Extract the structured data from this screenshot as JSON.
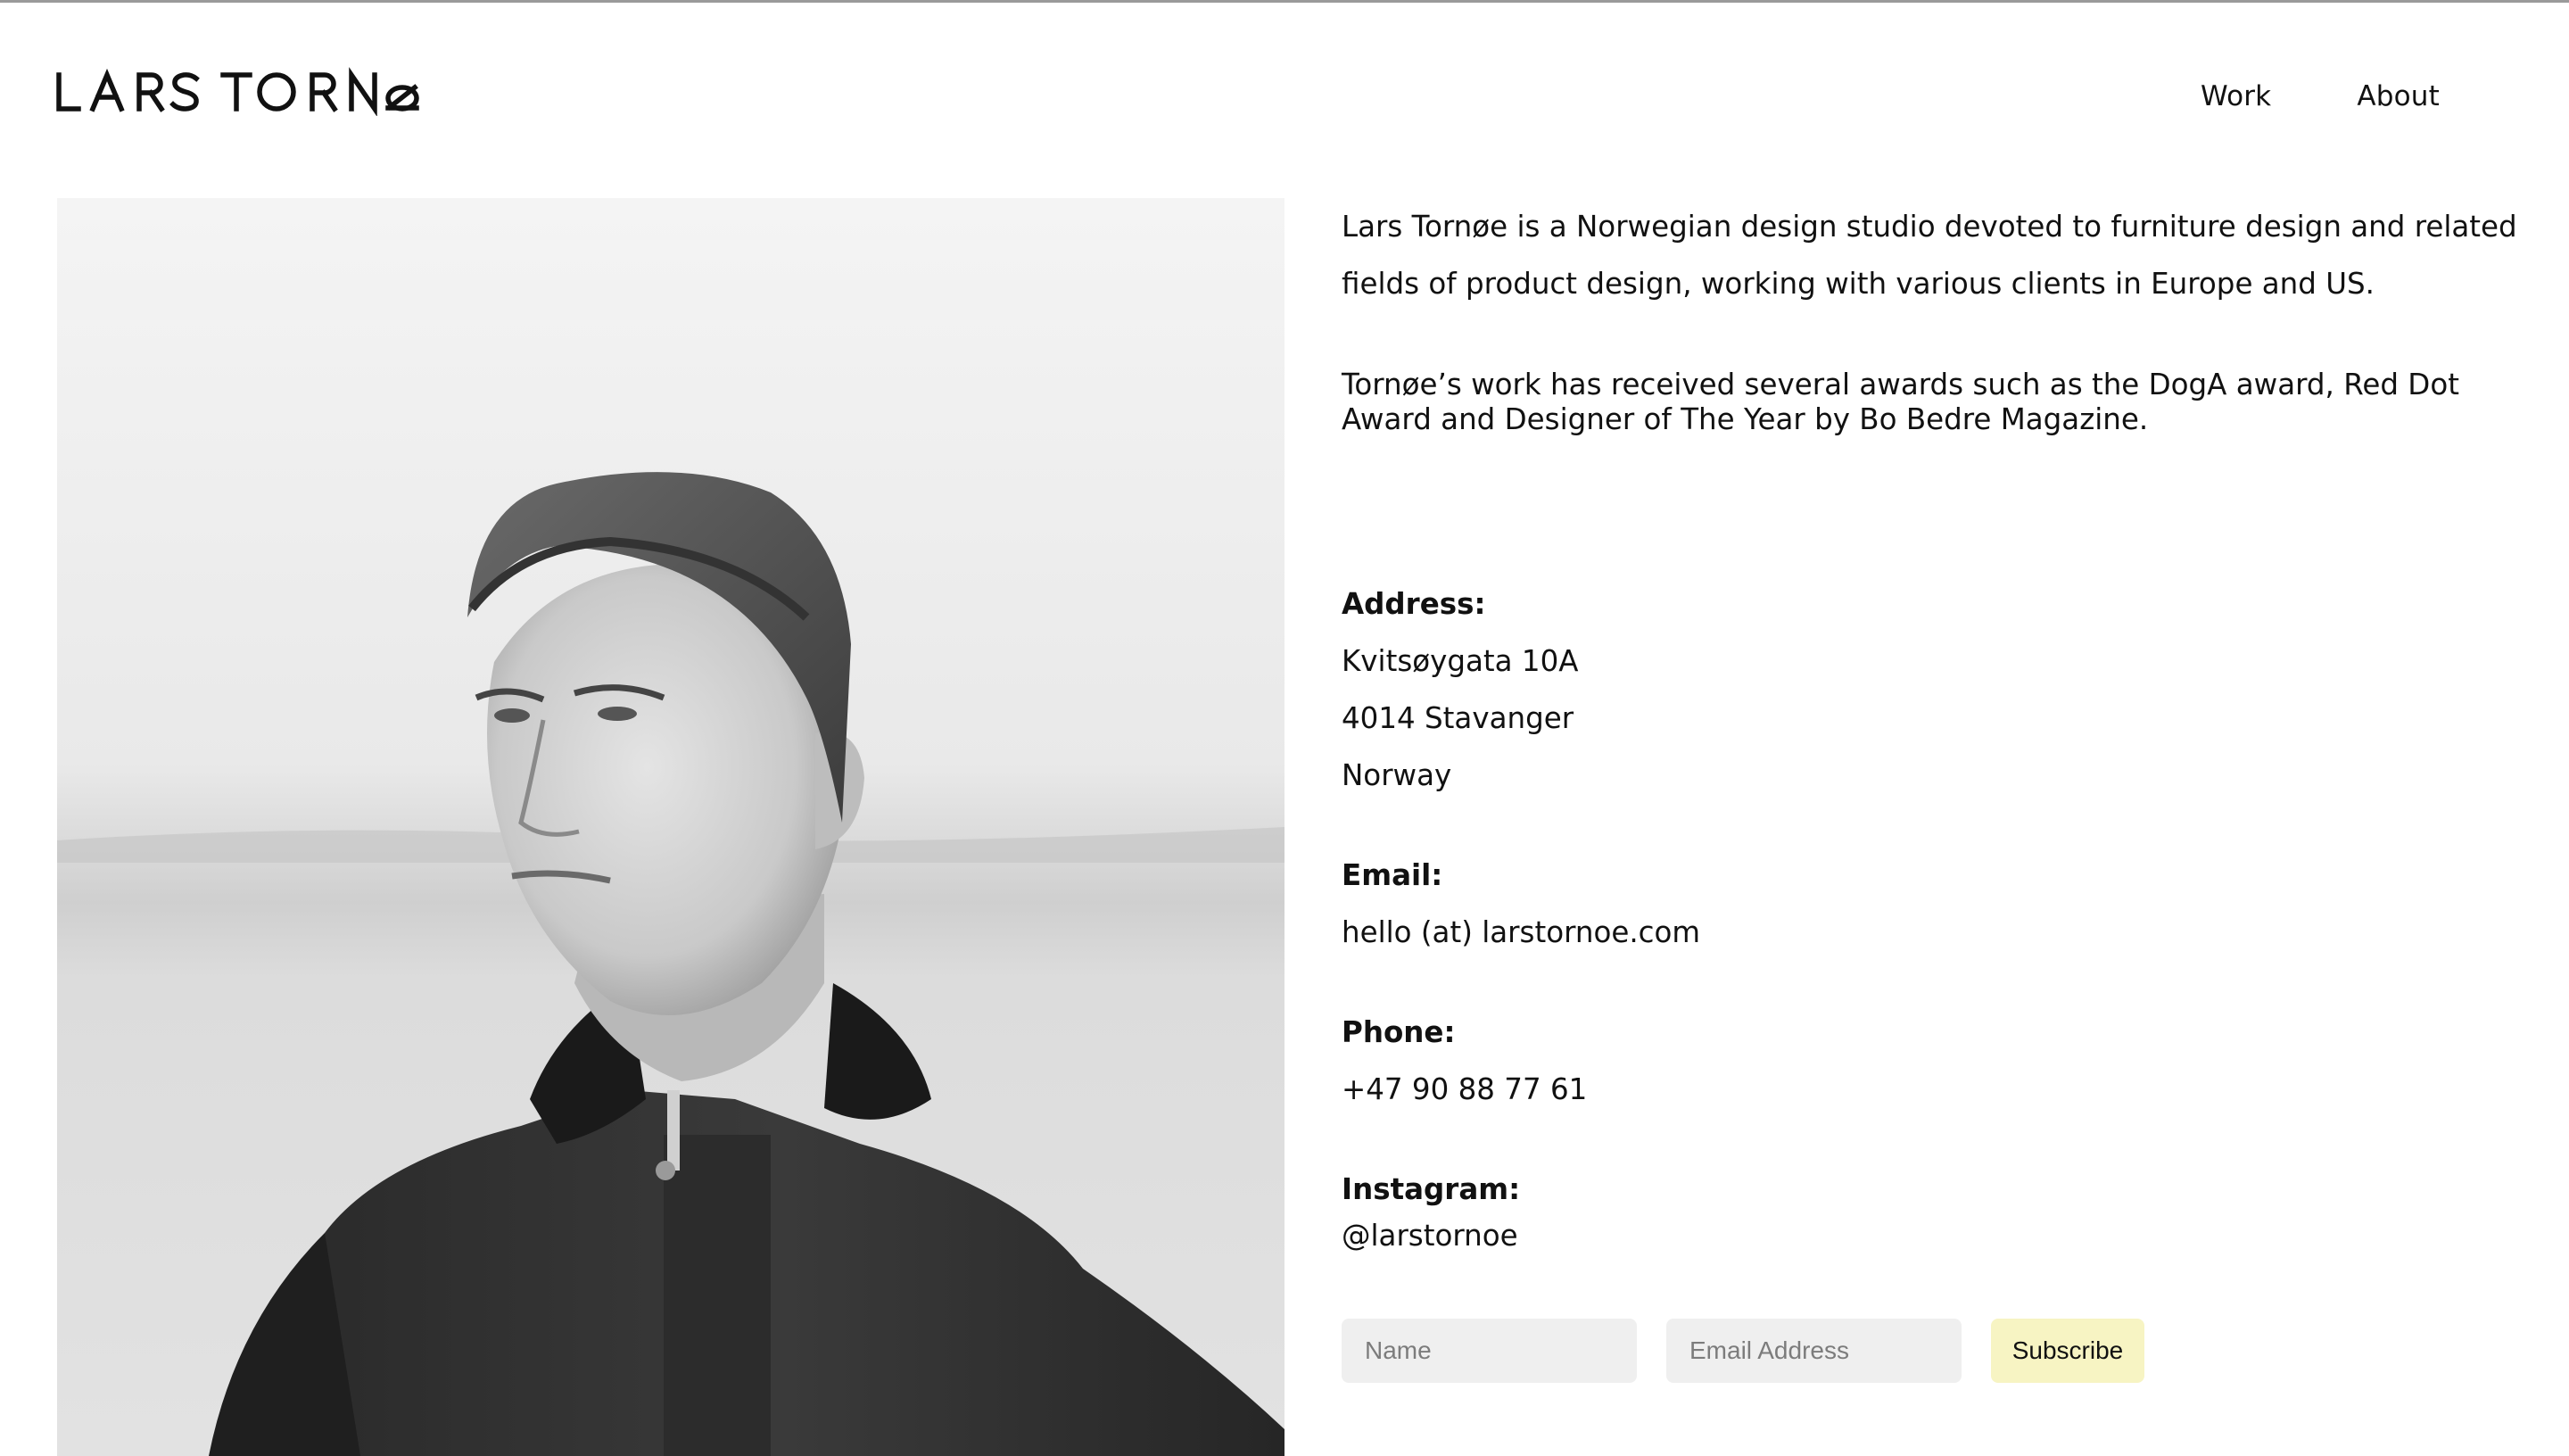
{
  "brand": {
    "logo_text": "LARS TORNØE"
  },
  "nav": {
    "items": [
      {
        "label": "Work"
      },
      {
        "label": "About"
      }
    ]
  },
  "about": {
    "intro": "Lars Tornøe is a Norwegian design studio devoted to furniture design and related fields of product design, working with various clients in Europe and US.",
    "awards": "Tornøe’s work has received several awards such as the DogA award, Red Dot Award and Designer of The Year by Bo Bedre Magazine."
  },
  "contact": {
    "address_label": "Address:",
    "address_lines": [
      "Kvitsøygata 10A",
      "4014 Stavanger",
      "Norway"
    ],
    "email_label": "Email:",
    "email": "hello (at) larstornoe.com",
    "phone_label": "Phone:",
    "phone": "+47 90 88 77 61",
    "instagram_label": "Instagram:",
    "instagram": "@larstornoe"
  },
  "newsletter": {
    "name_placeholder": "Name",
    "email_placeholder": "Email Address",
    "subscribe_label": "Subscribe"
  },
  "colors": {
    "subscribe_bg": "#f7f4c3",
    "input_bg": "#efefef"
  }
}
